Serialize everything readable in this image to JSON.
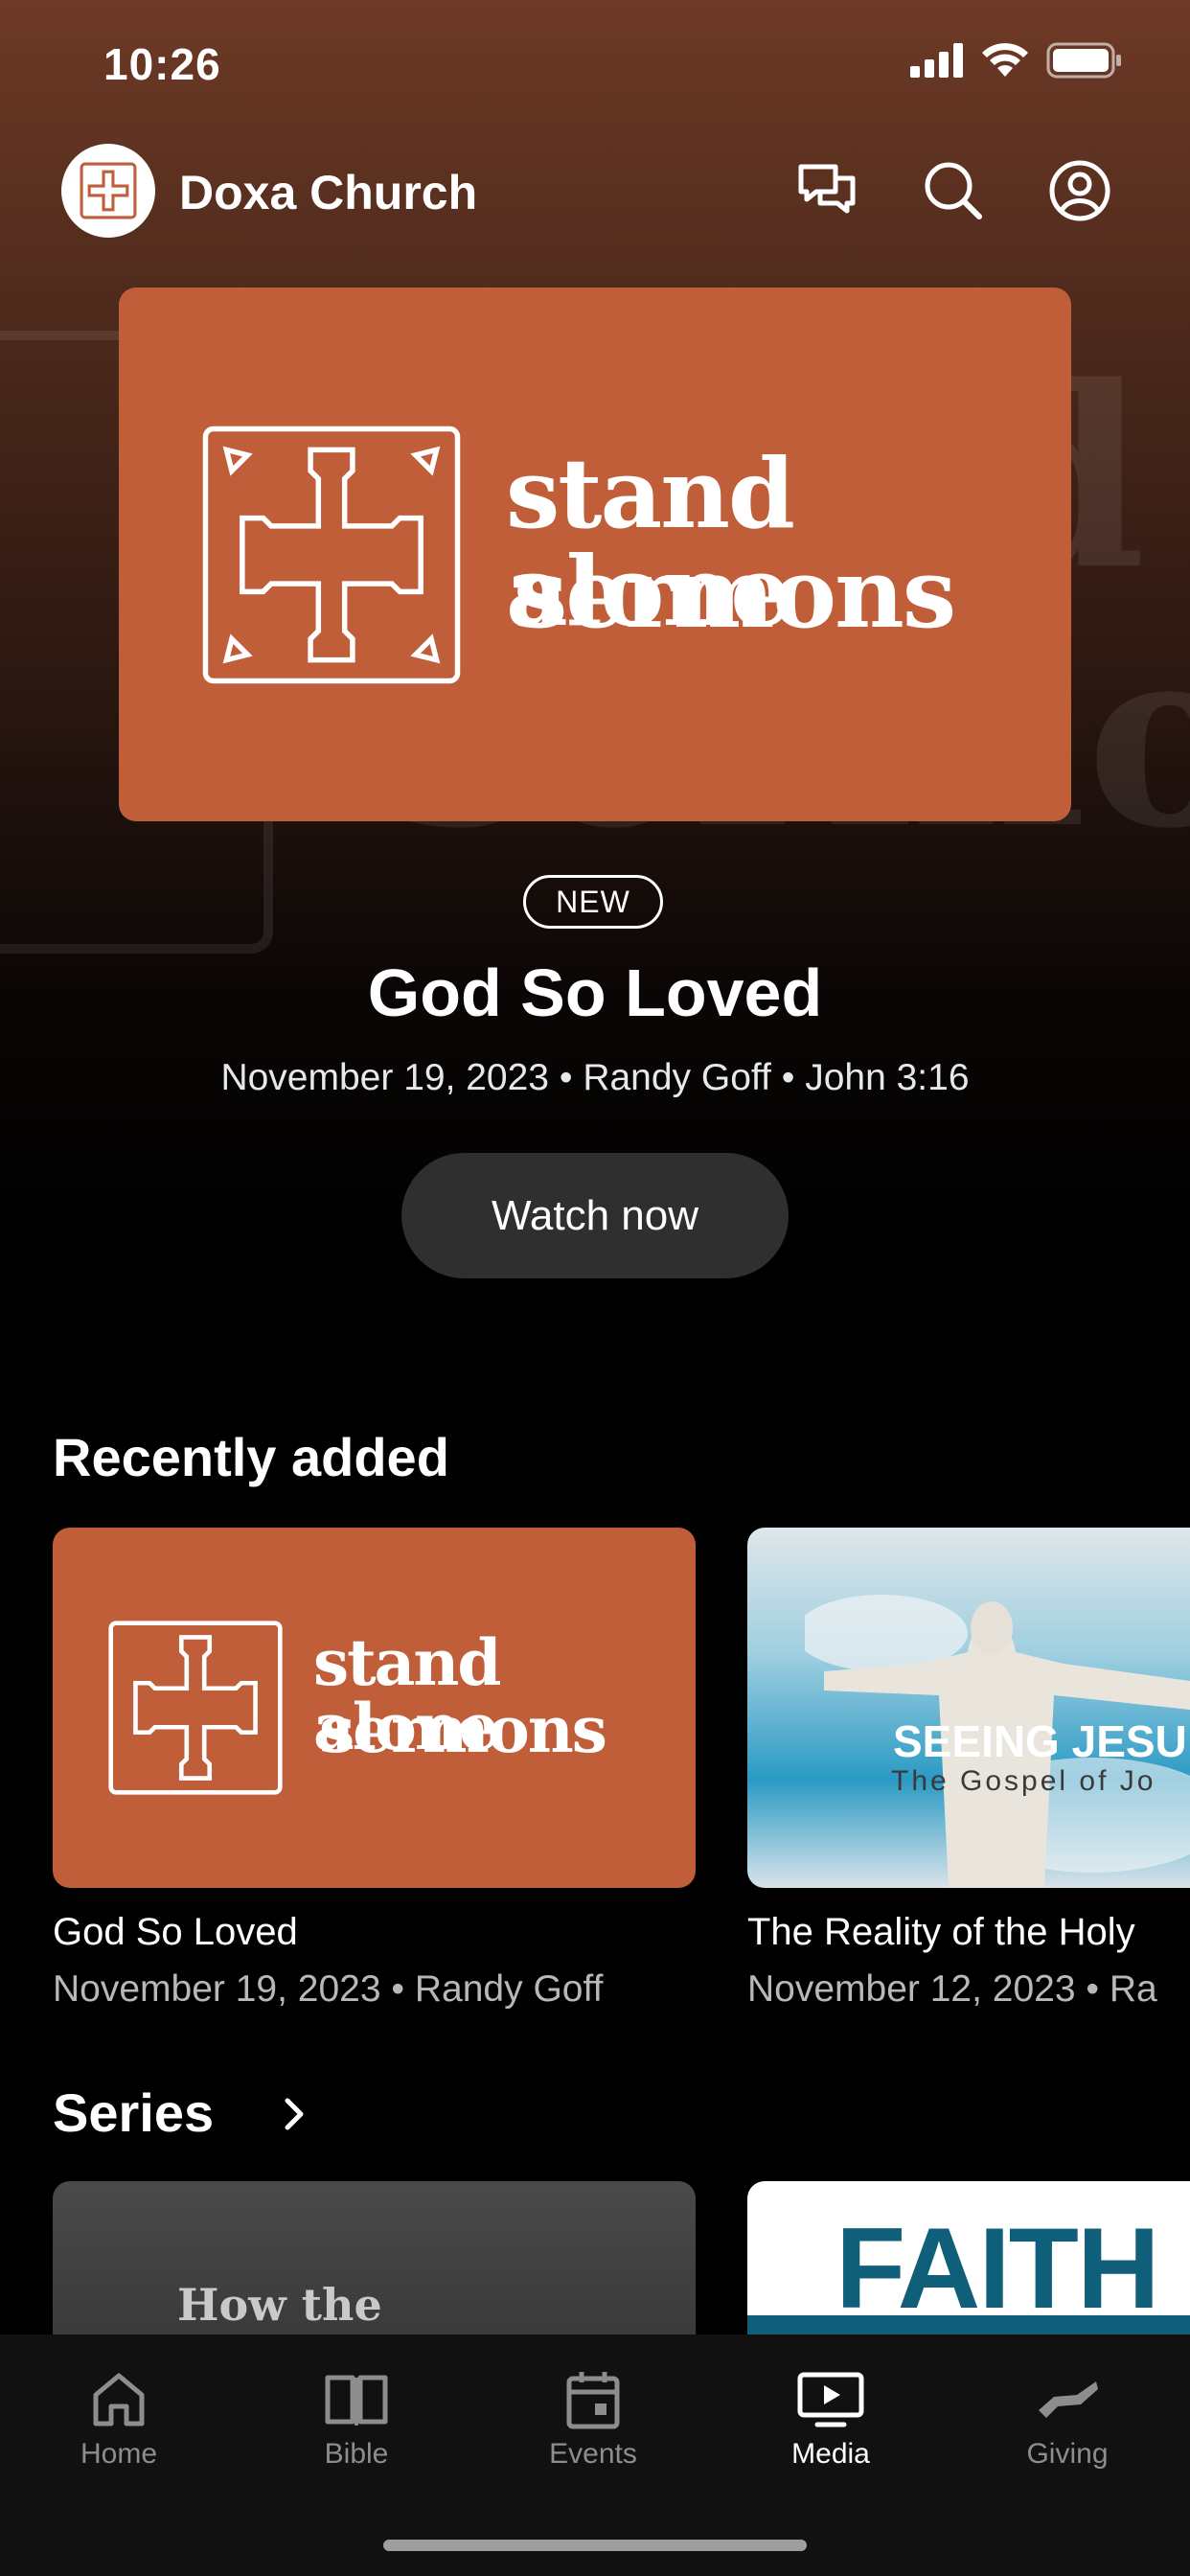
{
  "status_bar": {
    "time": "10:26"
  },
  "header": {
    "church_name": "Doxa Church"
  },
  "hero": {
    "art_line1": "stand alone",
    "art_line2": "sermons",
    "badge": "NEW",
    "title": "God So Loved",
    "meta": "November 19, 2023 • Randy Goff • John 3:16",
    "cta": "Watch now"
  },
  "recently_added": {
    "title": "Recently added",
    "items": [
      {
        "title": "God So Loved",
        "meta": "November 19, 2023 • Randy Goff",
        "art_line1": "stand alone",
        "art_line2": "sermons"
      },
      {
        "title": "The Reality of the Holy",
        "meta": "November 12, 2023 • Ra",
        "art_line1": "SEEING JESU",
        "art_line2": "The Gospel of Jo"
      }
    ]
  },
  "series": {
    "title": "Series",
    "items": [
      {
        "art_text": "How the"
      },
      {
        "art_text": "FAITH"
      }
    ]
  },
  "tabbar": {
    "tabs": [
      {
        "label": "Home"
      },
      {
        "label": "Bible"
      },
      {
        "label": "Events"
      },
      {
        "label": "Media"
      },
      {
        "label": "Giving"
      }
    ],
    "active": "Media"
  },
  "colors": {
    "brand": "#c05e3a",
    "background": "#000000",
    "button": "#2f2f2f"
  }
}
